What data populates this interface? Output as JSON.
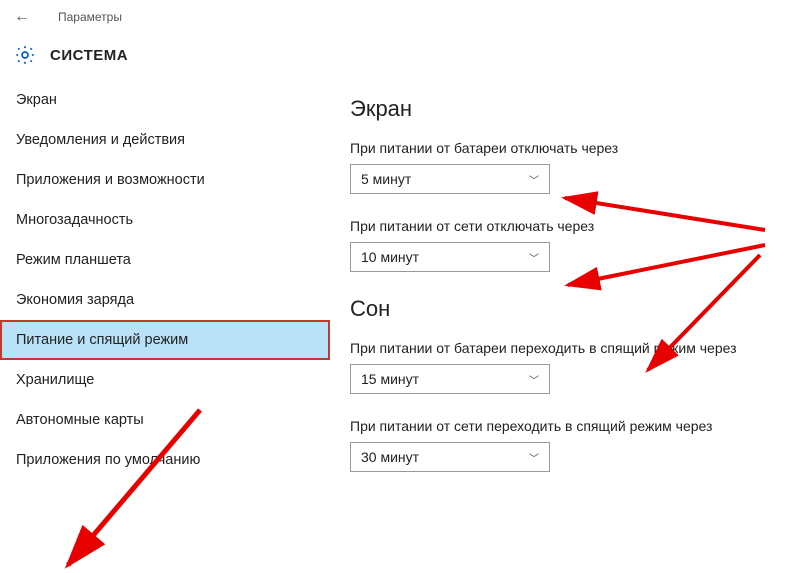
{
  "titlebar": {
    "label": "Параметры"
  },
  "header": {
    "title": "СИСТЕМА"
  },
  "sidebar": {
    "items": [
      {
        "label": "Экран",
        "selected": false
      },
      {
        "label": "Уведомления и действия",
        "selected": false
      },
      {
        "label": "Приложения и возможности",
        "selected": false
      },
      {
        "label": "Многозадачность",
        "selected": false
      },
      {
        "label": "Режим планшета",
        "selected": false
      },
      {
        "label": "Экономия заряда",
        "selected": false
      },
      {
        "label": "Питание и спящий режим",
        "selected": true
      },
      {
        "label": "Хранилище",
        "selected": false
      },
      {
        "label": "Автономные карты",
        "selected": false
      },
      {
        "label": "Приложения по умолчанию",
        "selected": false
      }
    ]
  },
  "main": {
    "section_screen": {
      "title": "Экран",
      "battery_label": "При питании от батареи отключать через",
      "battery_value": "5 минут",
      "plugged_label": "При питании от сети отключать через",
      "plugged_value": "10 минут"
    },
    "section_sleep": {
      "title": "Сон",
      "battery_label": "При питании от батареи переходить в спящий режим через",
      "battery_value": "15 минут",
      "plugged_label": "При питании от сети переходить в спящий режим через",
      "plugged_value": "30 минут"
    }
  },
  "annotation": {
    "arrow_color": "#e80000"
  }
}
